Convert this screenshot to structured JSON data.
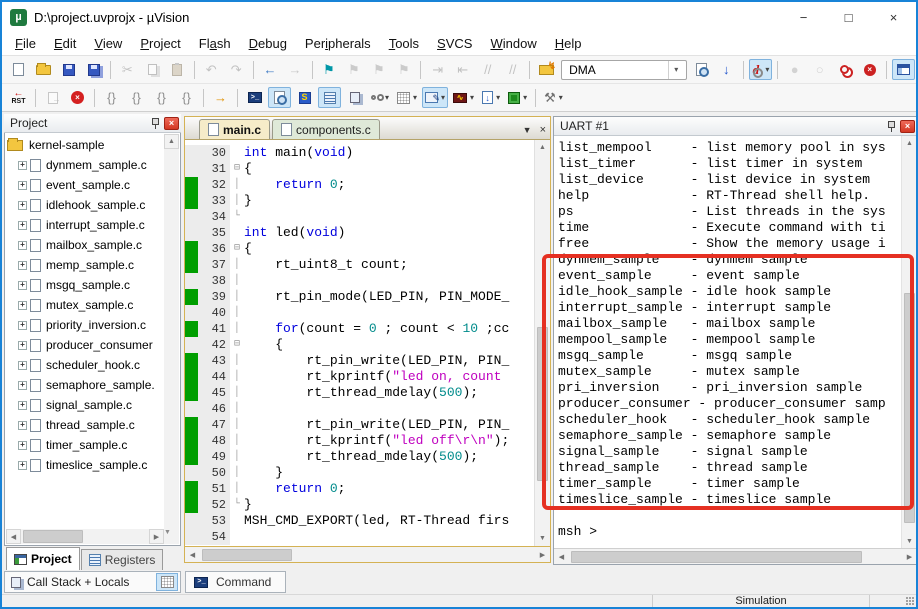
{
  "window": {
    "title": "D:\\project.uvprojx - µVision"
  },
  "colors": {
    "window_border": "#1883d7",
    "coverage_green": "#009e00",
    "annotation_red": "#e53022",
    "keyword_blue": "#0000dd",
    "number_teal": "#008b8b",
    "string_magenta": "#bf00bf",
    "active_tab_bg": "#f6ecc9",
    "inactive_tab_bg": "#dfe9d8",
    "toolbar_active_bg": "#cde6f8"
  },
  "menu": {
    "items": [
      {
        "label": "File",
        "u": 0
      },
      {
        "label": "Edit",
        "u": 0
      },
      {
        "label": "View",
        "u": 0
      },
      {
        "label": "Project",
        "u": 0
      },
      {
        "label": "Flash",
        "u": 2
      },
      {
        "label": "Debug",
        "u": 0
      },
      {
        "label": "Peripherals",
        "u": 3
      },
      {
        "label": "Tools",
        "u": 0
      },
      {
        "label": "SVCS",
        "u": 0
      },
      {
        "label": "Window",
        "u": 0
      },
      {
        "label": "Help",
        "u": 0
      }
    ]
  },
  "toolbars": {
    "row1": [
      {
        "name": "new-file-button",
        "shape": "page"
      },
      {
        "name": "open-file-button",
        "shape": "folder"
      },
      {
        "name": "save-button",
        "shape": "floppy"
      },
      {
        "name": "save-all-button",
        "shape": "floppy2"
      },
      {
        "sep": true
      },
      {
        "name": "cut-button",
        "glyph": "✂",
        "color": "#8f8f8f",
        "disabled": true
      },
      {
        "name": "copy-button",
        "shape": "copy",
        "disabled": true
      },
      {
        "name": "paste-button",
        "shape": "clipboard",
        "disabled": true
      },
      {
        "sep": true
      },
      {
        "name": "undo-button",
        "glyph": "↶",
        "color": "#8f8f8f",
        "disabled": true
      },
      {
        "name": "redo-button",
        "glyph": "↷",
        "color": "#8f8f8f",
        "disabled": true
      },
      {
        "sep": true
      },
      {
        "name": "navigate-back-button",
        "glyph": "←",
        "color": "#3b78c3"
      },
      {
        "name": "navigate-forward-button",
        "glyph": "→",
        "color": "#9a9a9a",
        "disabled": true
      },
      {
        "sep": true
      },
      {
        "name": "insert-bookmark-button",
        "glyph": "⚑",
        "color": "#0097a7"
      },
      {
        "name": "prev-bookmark-button",
        "glyph": "⚑",
        "color": "#a0a0a0",
        "disabled": true
      },
      {
        "name": "next-bookmark-button",
        "glyph": "⚑",
        "color": "#a0a0a0",
        "disabled": true
      },
      {
        "name": "clear-bookmarks-button",
        "glyph": "⚑",
        "color": "#a0a0a0",
        "disabled": true
      },
      {
        "sep": true
      },
      {
        "name": "indent-button",
        "glyph": "⇥",
        "color": "#8f8f8f",
        "disabled": true
      },
      {
        "name": "outdent-button",
        "glyph": "⇤",
        "color": "#8f8f8f",
        "disabled": true
      },
      {
        "name": "comment-button",
        "glyph": "//",
        "color": "#8f8f8f",
        "disabled": true
      },
      {
        "name": "uncomment-button",
        "glyph": "//",
        "color": "#8f8f8f",
        "disabled": true
      },
      {
        "sep": true
      },
      {
        "name": "load-application-button",
        "shape": "folder-flash"
      },
      {
        "name": "target-select",
        "combo": true,
        "value": "DMA"
      },
      {
        "name": "find-in-files-button",
        "shape": "page-find"
      },
      {
        "name": "download-button",
        "glyph": "↓",
        "color": "#2255cc"
      },
      {
        "sep": true
      },
      {
        "name": "start-stop-debug-button",
        "shape": "debug-d",
        "active": true,
        "dd": true
      },
      {
        "sep": true
      },
      {
        "name": "toggle-breakpoint-button",
        "glyph": "●",
        "color": "#b0b0b0",
        "disabled": true
      },
      {
        "name": "enable-breakpoint-button",
        "glyph": "○",
        "color": "#b0b0b0",
        "disabled": true
      },
      {
        "name": "disable-all-breakpoints-button",
        "shape": "bp-disable"
      },
      {
        "name": "kill-all-breakpoints-button",
        "shape": "bp-kill"
      },
      {
        "sep": true
      },
      {
        "name": "project-window-button",
        "shape": "window-blue",
        "active": true
      }
    ],
    "row2": [
      {
        "name": "reset-cpu-button",
        "glyph": "RST",
        "cls": "rst"
      },
      {
        "sep": true
      },
      {
        "name": "run-button",
        "shape": "run",
        "disabled": true
      },
      {
        "name": "stop-button",
        "shape": "stop"
      },
      {
        "sep": true
      },
      {
        "name": "step-in-button",
        "glyph": "{}",
        "color": "#8f8f8f"
      },
      {
        "name": "step-over-button",
        "glyph": "{}",
        "color": "#8f8f8f"
      },
      {
        "name": "step-out-button",
        "glyph": "{}",
        "color": "#8f8f8f"
      },
      {
        "name": "run-to-cursor-button",
        "glyph": "{}",
        "color": "#8f8f8f"
      },
      {
        "sep": true
      },
      {
        "name": "show-next-statement-button",
        "glyph": "→",
        "color": "#e09000"
      },
      {
        "sep": true
      },
      {
        "name": "command-window-button",
        "shape": "console"
      },
      {
        "name": "disassembly-window-button",
        "shape": "page-find",
        "active": true
      },
      {
        "name": "symbol-window-button",
        "shape": "symbols"
      },
      {
        "name": "registers-window-button",
        "shape": "reg",
        "active": true
      },
      {
        "name": "call-stack-window-button",
        "shape": "callstack"
      },
      {
        "name": "watch-window-button",
        "shape": "watch",
        "dd": true
      },
      {
        "name": "memory-window-button",
        "shape": "grid",
        "dd": true
      },
      {
        "name": "serial-window-button",
        "shape": "serial",
        "active": true,
        "dd": true
      },
      {
        "name": "analysis-window-button",
        "shape": "logic",
        "dd": true
      },
      {
        "name": "trace-window-button",
        "shape": "trace",
        "dd": true
      },
      {
        "name": "system-viewer-button",
        "shape": "sysview",
        "dd": true
      },
      {
        "sep": true
      },
      {
        "name": "debug-toolbox-button",
        "glyph": "⚒",
        "color": "#707070",
        "dd": true
      }
    ]
  },
  "project": {
    "title": "Project",
    "root": "kernel-sample",
    "files": [
      "dynmem_sample.c",
      "event_sample.c",
      "idlehook_sample.c",
      "interrupt_sample.c",
      "mailbox_sample.c",
      "memp_sample.c",
      "msgq_sample.c",
      "mutex_sample.c",
      "priority_inversion.c",
      "producer_consumer",
      "scheduler_hook.c",
      "semaphore_sample.",
      "signal_sample.c",
      "thread_sample.c",
      "timer_sample.c",
      "timeslice_sample.c"
    ]
  },
  "editor": {
    "tabs": [
      {
        "label": "main.c",
        "active": true
      },
      {
        "label": "components.c",
        "active": false
      }
    ],
    "lines": [
      {
        "n": 30,
        "f": "",
        "g": 0,
        "t": [
          [
            "kw",
            "int"
          ],
          [
            "pl",
            " main("
          ],
          [
            "kw",
            "void"
          ],
          [
            "pl",
            ")"
          ]
        ]
      },
      {
        "n": 31,
        "f": "⊟",
        "g": 0,
        "t": [
          [
            "pl",
            "{"
          ]
        ]
      },
      {
        "n": 32,
        "f": "│",
        "g": 1,
        "t": [
          [
            "pl",
            "    "
          ],
          [
            "kw",
            "return"
          ],
          [
            "pl",
            " "
          ],
          [
            "num",
            "0"
          ],
          [
            "pl",
            ";"
          ]
        ]
      },
      {
        "n": 33,
        "f": "│",
        "g": 1,
        "t": [
          [
            "pl",
            "}"
          ]
        ]
      },
      {
        "n": 34,
        "f": "└",
        "g": 0,
        "t": []
      },
      {
        "n": 35,
        "f": "",
        "g": 0,
        "t": [
          [
            "kw",
            "int"
          ],
          [
            "pl",
            " led("
          ],
          [
            "kw",
            "void"
          ],
          [
            "pl",
            ")"
          ]
        ]
      },
      {
        "n": 36,
        "f": "⊟",
        "g": 1,
        "t": [
          [
            "pl",
            "{"
          ]
        ]
      },
      {
        "n": 37,
        "f": "│",
        "g": 1,
        "t": [
          [
            "pl",
            "    rt_uint8_t count;"
          ]
        ]
      },
      {
        "n": 38,
        "f": "│",
        "g": 0,
        "t": []
      },
      {
        "n": 39,
        "f": "│",
        "g": 1,
        "t": [
          [
            "pl",
            "    rt_pin_mode(LED_PIN, PIN_MODE_"
          ]
        ]
      },
      {
        "n": 40,
        "f": "│",
        "g": 0,
        "t": []
      },
      {
        "n": 41,
        "f": "│",
        "g": 1,
        "t": [
          [
            "pl",
            "    "
          ],
          [
            "kw",
            "for"
          ],
          [
            "pl",
            "(count = "
          ],
          [
            "num",
            "0"
          ],
          [
            "pl",
            " ; count < "
          ],
          [
            "num",
            "10"
          ],
          [
            "pl",
            " ;cc"
          ]
        ]
      },
      {
        "n": 42,
        "f": "⊟",
        "g": 0,
        "t": [
          [
            "pl",
            "    {"
          ]
        ]
      },
      {
        "n": 43,
        "f": "│",
        "g": 1,
        "t": [
          [
            "pl",
            "        rt_pin_write(LED_PIN, PIN_"
          ]
        ]
      },
      {
        "n": 44,
        "f": "│",
        "g": 1,
        "t": [
          [
            "pl",
            "        rt_kprintf("
          ],
          [
            "str",
            "\"led on, count"
          ]
        ]
      },
      {
        "n": 45,
        "f": "│",
        "g": 1,
        "t": [
          [
            "pl",
            "        rt_thread_mdelay("
          ],
          [
            "num",
            "500"
          ],
          [
            "pl",
            ");"
          ]
        ]
      },
      {
        "n": 46,
        "f": "│",
        "g": 0,
        "t": []
      },
      {
        "n": 47,
        "f": "│",
        "g": 1,
        "t": [
          [
            "pl",
            "        rt_pin_write(LED_PIN, PIN_"
          ]
        ]
      },
      {
        "n": 48,
        "f": "│",
        "g": 1,
        "t": [
          [
            "pl",
            "        rt_kprintf("
          ],
          [
            "str",
            "\"led off\\r\\n\""
          ],
          [
            "pl",
            ");"
          ]
        ]
      },
      {
        "n": 49,
        "f": "│",
        "g": 1,
        "t": [
          [
            "pl",
            "        rt_thread_mdelay("
          ],
          [
            "num",
            "500"
          ],
          [
            "pl",
            ");"
          ]
        ]
      },
      {
        "n": 50,
        "f": "│",
        "g": 0,
        "t": [
          [
            "pl",
            "    }"
          ]
        ]
      },
      {
        "n": 51,
        "f": "│",
        "g": 1,
        "t": [
          [
            "pl",
            "    "
          ],
          [
            "kw",
            "return"
          ],
          [
            "pl",
            " "
          ],
          [
            "num",
            "0"
          ],
          [
            "pl",
            ";"
          ]
        ]
      },
      {
        "n": 52,
        "f": "└",
        "g": 1,
        "t": [
          [
            "pl",
            "}"
          ]
        ]
      },
      {
        "n": 53,
        "f": "",
        "g": 0,
        "t": [
          [
            "pl",
            "MSH_CMD_EXPORT(led, RT-Thread firs"
          ]
        ]
      },
      {
        "n": 54,
        "f": "",
        "g": 0,
        "t": []
      }
    ]
  },
  "uart": {
    "title": "UART #1",
    "lines": [
      "list_mempool     - list memory pool in sys",
      "list_timer       - list timer in system",
      "list_device      - list device in system",
      "help             - RT-Thread shell help.",
      "ps               - List threads in the sys",
      "time             - Execute command with ti",
      "free             - Show the memory usage i",
      "dynmem_sample    - dynmem sample",
      "event_sample     - event sample",
      "idle_hook_sample - idle hook sample",
      "interrupt_sample - interrupt sample",
      "mailbox_sample   - mailbox sample",
      "mempool_sample   - mempool sample",
      "msgq_sample      - msgq sample",
      "mutex_sample     - mutex sample",
      "pri_inversion    - pri_inversion sample",
      "producer_consumer - producer_consumer samp",
      "scheduler_hook   - scheduler_hook sample",
      "semaphore_sample - semaphore sample",
      "signal_sample    - signal sample",
      "thread_sample    - thread sample",
      "timer_sample     - timer sample",
      "timeslice_sample - timeslice sample",
      "",
      "msh >"
    ]
  },
  "bottom_tabs": {
    "project": "Project",
    "registers": "Registers"
  },
  "callstack": {
    "label": "Call Stack + Locals"
  },
  "command": {
    "label": "Command"
  },
  "status": {
    "simulation": "Simulation"
  },
  "annotation": {
    "shape": "rectangle",
    "color": "#e53022"
  }
}
